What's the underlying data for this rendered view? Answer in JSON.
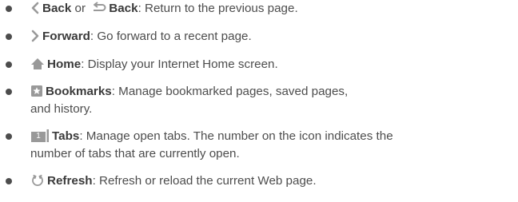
{
  "items": [
    {
      "icon": "chevron-left-icon",
      "term": "Back",
      "joiner": " or ",
      "icon2": "back-arrow-icon",
      "term2": "Back",
      "desc": ": Return to the previous page."
    },
    {
      "icon": "chevron-right-icon",
      "term": "Forward",
      "desc": ": Go forward to a recent page."
    },
    {
      "icon": "home-icon",
      "term": "Home",
      "desc": ": Display your Internet Home screen."
    },
    {
      "icon": "bookmark-star-icon",
      "term": "Bookmarks",
      "desc": ": Manage bookmarked pages, saved pages,",
      "desc_cont": "and history."
    },
    {
      "icon": "tabs-icon",
      "icon_count": "1",
      "term": "Tabs",
      "desc": ": Manage open tabs. The number on the icon indicates the",
      "desc_cont": "number of tabs that are currently open."
    },
    {
      "icon": "refresh-icon",
      "term": "Refresh",
      "desc": ": Refresh or reload the current Web page."
    }
  ],
  "colors": {
    "text": "#4d4d4d",
    "icon": "#999999"
  }
}
